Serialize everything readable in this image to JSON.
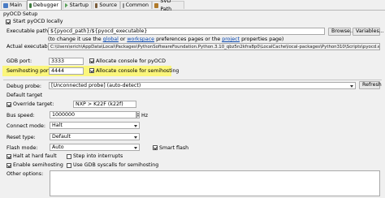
{
  "tabs": [
    {
      "label": "Main",
      "icon": "main-icon",
      "color": "#4a7cc4"
    },
    {
      "label": "Debugger",
      "icon": "debugger-icon",
      "color": "#3d7a3d"
    },
    {
      "label": "Startup",
      "icon": "startup-icon",
      "color": "#5aa05a"
    },
    {
      "label": "Source",
      "icon": "source-icon",
      "color": "#7a5c3a"
    },
    {
      "label": "Common",
      "icon": "common-icon",
      "color": "#8a8a8a"
    },
    {
      "label": "SVD Path",
      "icon": "svd-path-icon",
      "color": "#b07a2a"
    }
  ],
  "pyocd": {
    "section_title": "pyOCD Setup",
    "start_locally_label": "Start pyOCD locally",
    "executable_path_label": "Executable path:",
    "executable_path_value": "${pyocd_path}/${pyocd_executable}",
    "browse_label": "Browse...",
    "variables_label": "Variables...",
    "hint_prefix": "(to change it use the ",
    "hint_global": "global",
    "hint_or": " or ",
    "hint_workspace": "workspace",
    "hint_middle": " preferences pages or the ",
    "hint_project": "project",
    "hint_suffix": " properties page)",
    "actual_executable_label": "Actual executable:",
    "actual_executable_value": "C:\\Users\\erich\\AppData\\Local\\Packages\\PythonSoftwareFoundation.Python.3.10_qbz5n2kfra8p0\\LocalCache\\local-packages\\Python310\\Scripts\\pyocd.exe",
    "gdb_port_label": "GDB port:",
    "gdb_port_value": "3333",
    "allocate_console_label": "Allocate console for pyOCD",
    "semihosting_port_label": "Semihosting port:",
    "semihosting_port_value": "4444",
    "allocate_semihosting_label": "Allocate console for semihosting",
    "debug_probe_label": "Debug probe:",
    "debug_probe_value": "[Unconnected probe] (auto-detect)",
    "refresh_label": "Refresh",
    "default_target_label": "Default target",
    "override_target_label": "Override target:",
    "override_target_value": "NXP > K22F (k22f)",
    "bus_speed_label": "Bus speed:",
    "bus_speed_value": "1000000",
    "bus_speed_unit": "Hz",
    "connect_mode_label": "Connect mode:",
    "connect_mode_value": "Halt",
    "reset_type_label": "Reset type:",
    "reset_type_value": "Default",
    "flash_mode_label": "Flash mode:",
    "flash_mode_value": "Auto",
    "smart_flash_label": "Smart flash",
    "halt_hard_fault_label": "Halt at hard fault",
    "step_interrupts_label": "Step into interrupts",
    "enable_semihosting_label": "Enable semihosting",
    "gdb_syscalls_label": "Use GDB syscalls for semihosting",
    "other_options_label": "Other options:",
    "other_options_value": ""
  },
  "colors": {
    "highlight": "#fbf67c",
    "link": "#0645ad"
  }
}
